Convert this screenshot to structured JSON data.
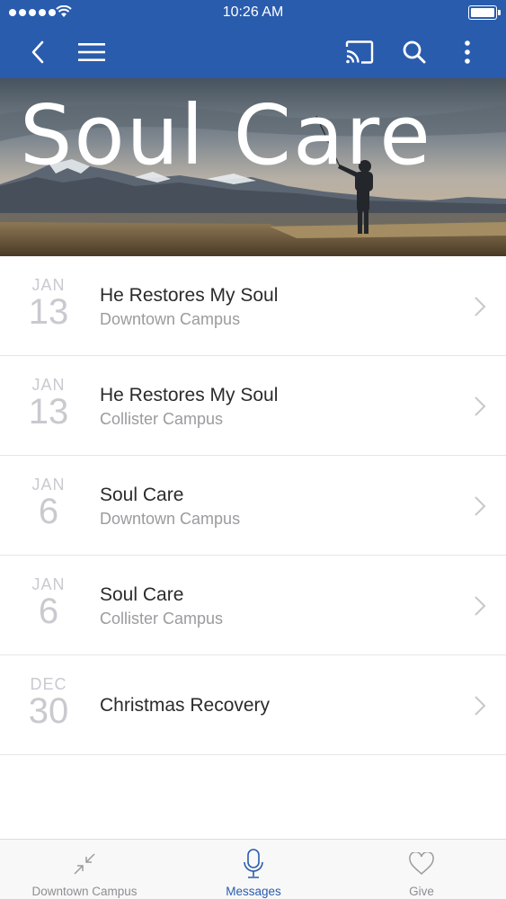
{
  "status_bar": {
    "time": "10:26 AM"
  },
  "hero": {
    "title": "Soul Care"
  },
  "messages": [
    {
      "month": "JAN",
      "day": "13",
      "title": "He Restores My Soul",
      "campus": "Downtown Campus"
    },
    {
      "month": "JAN",
      "day": "13",
      "title": "He Restores My Soul",
      "campus": "Collister Campus"
    },
    {
      "month": "JAN",
      "day": "6",
      "title": "Soul Care",
      "campus": "Downtown Campus"
    },
    {
      "month": "JAN",
      "day": "6",
      "title": "Soul Care",
      "campus": "Collister Campus"
    },
    {
      "month": "DEC",
      "day": "30",
      "title": "Christmas Recovery",
      "campus": ""
    }
  ],
  "tabs": [
    {
      "label": "Downtown Campus",
      "icon": "collapse-arrows-icon",
      "active": false
    },
    {
      "label": "Messages",
      "icon": "microphone-icon",
      "active": true
    },
    {
      "label": "Give",
      "icon": "heart-icon",
      "active": false
    }
  ],
  "colors": {
    "brand_blue": "#2a5cad",
    "date_grey": "#c9c9cf",
    "subtitle_grey": "#9b9b9f"
  }
}
